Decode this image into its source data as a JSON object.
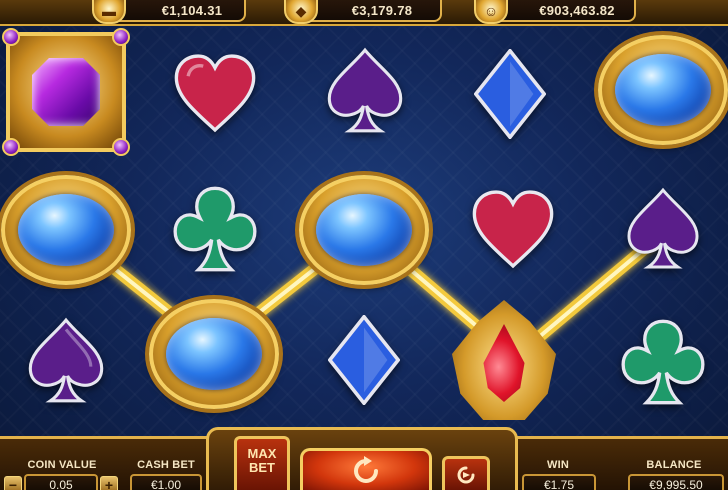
{
  "jackpots": [
    {
      "name": "gold-bars",
      "value": "€1,104.31",
      "icon": "gold-bars-icon"
    },
    {
      "name": "diamond",
      "value": "€3,179.78",
      "icon": "diamond-icon"
    },
    {
      "name": "jester",
      "value": "€903,463.82",
      "icon": "jester-icon"
    }
  ],
  "symbols": {
    "blue_sapphire": "blue-sapphire-icon",
    "amethyst": "amethyst-icon",
    "ruby": "ruby-icon",
    "heart": "heart-icon",
    "spade": "spade-icon",
    "club": "club-icon",
    "diamond": "diamond-suit-icon"
  },
  "colors": {
    "heart": "#c8244a",
    "spade": "#5a1e8a",
    "club": "#1f9a6a",
    "diamond": "#2a5ee0",
    "payline": "#ffd23a",
    "frame_gold": "#e3b24a"
  },
  "controls": {
    "coin_value_label": "COIN VALUE",
    "coin_value": "0.05",
    "cash_bet_label": "CASH BET",
    "cash_bet": "€1.00",
    "max_bet_label_1": "MAX",
    "max_bet_label_2": "BET",
    "win_label": "WIN",
    "win_value": "€1.75",
    "balance_label": "BALANCE",
    "balance_value": "€9,995.50",
    "minus": "−",
    "plus": "+"
  }
}
